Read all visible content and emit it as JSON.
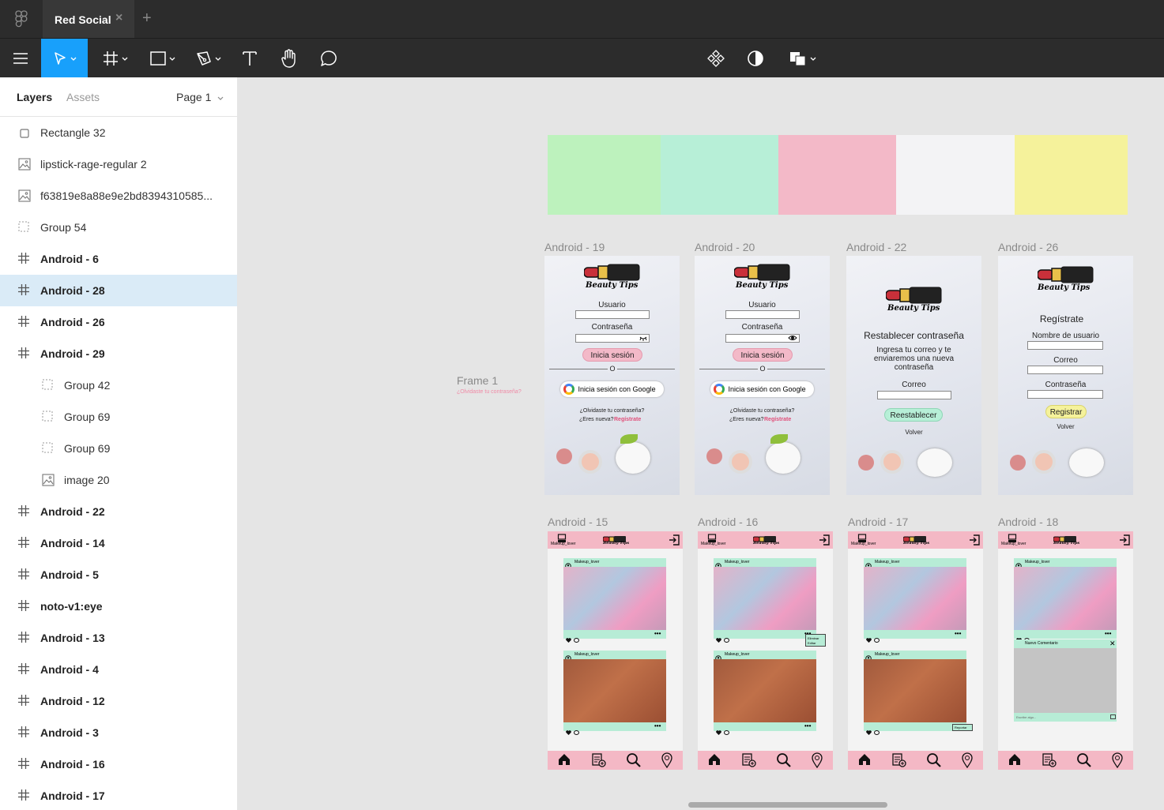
{
  "tab": {
    "title": "Red Social",
    "close": "×",
    "add": "+"
  },
  "panel": {
    "tabs": {
      "layers": "Layers",
      "assets": "Assets"
    },
    "page": "Page 1",
    "layers": [
      {
        "label": "Rectangle 32",
        "icon": "rectangle-icon"
      },
      {
        "label": "lipstick-rage-regular 2",
        "icon": "image-icon"
      },
      {
        "label": "f63819e8a88e9e2bd8394310585...",
        "icon": "image-icon"
      },
      {
        "label": "Group 54",
        "icon": "group-icon"
      },
      {
        "label": "Android - 6",
        "icon": "frame-icon"
      },
      {
        "label": "Android - 28",
        "icon": "frame-icon"
      },
      {
        "label": "Android - 26",
        "icon": "frame-icon"
      },
      {
        "label": "Android - 29",
        "icon": "frame-icon"
      },
      {
        "label": "Group 42",
        "icon": "group-icon"
      },
      {
        "label": "Group 69",
        "icon": "group-icon"
      },
      {
        "label": "Group 69",
        "icon": "group-icon"
      },
      {
        "label": "image 20",
        "icon": "image-icon"
      },
      {
        "label": "Android - 22",
        "icon": "frame-icon"
      },
      {
        "label": "Android - 14",
        "icon": "frame-icon"
      },
      {
        "label": "Android - 5",
        "icon": "frame-icon"
      },
      {
        "label": "noto-v1:eye",
        "icon": "frame-icon"
      },
      {
        "label": "Android - 13",
        "icon": "frame-icon"
      },
      {
        "label": "Android - 4",
        "icon": "frame-icon"
      },
      {
        "label": "Android - 12",
        "icon": "frame-icon"
      },
      {
        "label": "Android - 3",
        "icon": "frame-icon"
      },
      {
        "label": "Android - 16",
        "icon": "frame-icon"
      },
      {
        "label": "Android - 17",
        "icon": "frame-icon"
      }
    ]
  },
  "palette": [
    "#bdf2bd",
    "#b7efd7",
    "#f3b9c8",
    "#f3f3f5",
    "#f5f29b"
  ],
  "frame1": {
    "label": "Frame 1",
    "note": "¿Olvidaste tu contraseña?"
  },
  "login": {
    "brand": "Beauty Tips",
    "user": "Usuario",
    "password": "Contraseña",
    "signin": "Inicia sesión",
    "or": "O",
    "google": "Inicia sesión con Google",
    "forgot": "¿Olvidaste tu contraseña?",
    "new_q": "¿Eres nueva?",
    "register_link": "Regístrate"
  },
  "reset": {
    "title": "Restablecer contraseña",
    "desc": "Ingresa tu correo y te enviaremos una nueva contraseña",
    "email": "Correo",
    "button": "Reestablecer",
    "back": "Volver"
  },
  "register": {
    "title": "Regístrate",
    "username": "Nombre de usuario",
    "email": "Correo",
    "password": "Contraseña",
    "button": "Registrar",
    "back": "Volver"
  },
  "frames_top": [
    "Android - 19",
    "Android - 20",
    "Android - 22",
    "Android - 26"
  ],
  "frames_bottom": [
    "Android - 15",
    "Android - 16",
    "Android - 17",
    "Android - 18"
  ],
  "feed": {
    "user": "Makeup_lover",
    "post_user": "Makeup_lover",
    "menu_delete": "Eliminar",
    "menu_edit": "Editar",
    "report": "Reportar",
    "new_comment": "Nuevo Comentario",
    "write": "Escribe algo..."
  }
}
